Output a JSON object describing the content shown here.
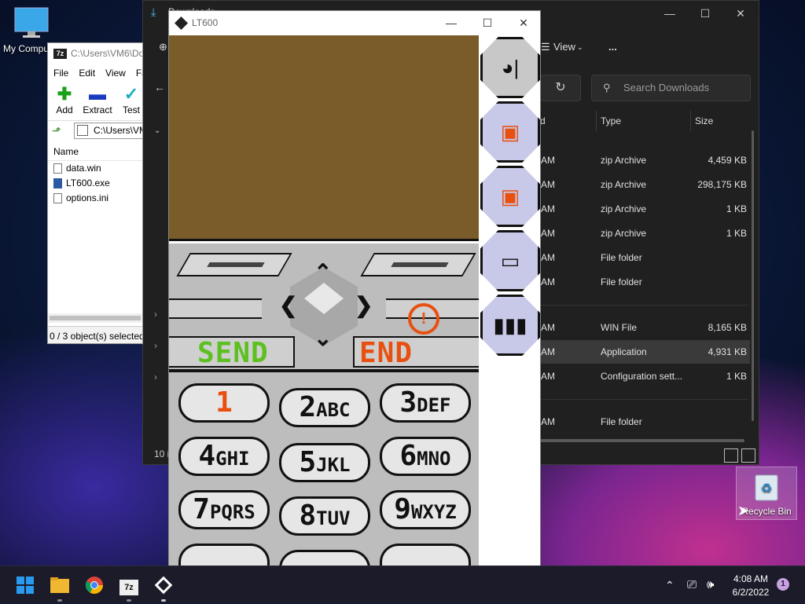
{
  "desktop": {
    "my_computer_label": "My Computer",
    "recycle_bin_label": "Recycle Bin"
  },
  "explorer": {
    "title": "Downloads",
    "view_label": "View",
    "more_label": "...",
    "search_placeholder": "Search Downloads",
    "columns": {
      "date": "d",
      "type": "Type",
      "size": "Size"
    },
    "rows": [
      {
        "time": "AM",
        "type": "zip Archive",
        "size": "4,459 KB",
        "selected": false
      },
      {
        "time": "AM",
        "type": "zip Archive",
        "size": "298,175 KB",
        "selected": false
      },
      {
        "time": "AM",
        "type": "zip Archive",
        "size": "1 KB",
        "selected": false
      },
      {
        "time": "AM",
        "type": "zip Archive",
        "size": "1 KB",
        "selected": false
      },
      {
        "time": "AM",
        "type": "File folder",
        "size": "",
        "selected": false
      },
      {
        "time": "AM",
        "type": "File folder",
        "size": "",
        "selected": false
      },
      {
        "time": "AM",
        "type": "WIN File",
        "size": "8,165 KB",
        "selected": false
      },
      {
        "time": "AM",
        "type": "Application",
        "size": "4,931 KB",
        "selected": true
      },
      {
        "time": "AM",
        "type": "Configuration sett...",
        "size": "1 KB",
        "selected": false
      },
      {
        "time": "AM",
        "type": "File folder",
        "size": "",
        "selected": false
      }
    ],
    "status_count": "10 i"
  },
  "sevenzip": {
    "title": "C:\\Users\\VM6\\Do",
    "menu": [
      "File",
      "Edit",
      "View",
      "Fa"
    ],
    "toolbar": {
      "add": "Add",
      "extract": "Extract",
      "test": "Test"
    },
    "path": "C:\\Users\\VM",
    "list_header": "Name",
    "files": [
      "data.win",
      "LT600.exe",
      "options.ini"
    ],
    "status": "0 / 3 object(s) selected"
  },
  "lt600": {
    "title": "LT600",
    "send_label": "SEND",
    "end_label": "END",
    "keys": [
      {
        "digit": "1",
        "letters": ""
      },
      {
        "digit": "2",
        "letters": "ABC"
      },
      {
        "digit": "3",
        "letters": "DEF"
      },
      {
        "digit": "4",
        "letters": "GHI"
      },
      {
        "digit": "5",
        "letters": "JKL"
      },
      {
        "digit": "6",
        "letters": "MNO"
      },
      {
        "digit": "7",
        "letters": "PQRS"
      },
      {
        "digit": "8",
        "letters": "TUV"
      },
      {
        "digit": "9",
        "letters": "WXYZ"
      }
    ],
    "screen_color": "#7a5c2a",
    "accent_send": "#5cc020",
    "accent_end": "#e85010",
    "sidebar_buttons": [
      "signal-icon",
      "load-state-icon",
      "save-state-icon",
      "battery-low-icon",
      "battery-full-icon"
    ]
  },
  "taskbar": {
    "time": "4:08 AM",
    "date": "6/2/2022",
    "notification_count": "1"
  }
}
